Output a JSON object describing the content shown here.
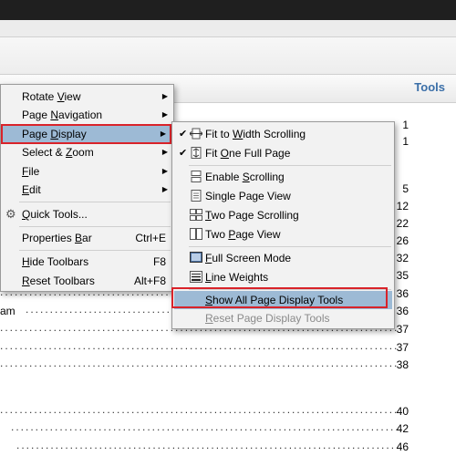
{
  "header": {
    "tools_label": "Tools"
  },
  "toc_numbers": [
    "1",
    "1",
    "5",
    "12",
    "22",
    "26",
    "32",
    "35",
    "36",
    "36",
    "37",
    "37",
    "38",
    "40",
    "42",
    "46"
  ],
  "toc_fragment": "am",
  "context_menu": {
    "items": [
      {
        "label_pre": "Rotate ",
        "label_u": "V",
        "label_post": "iew"
      },
      {
        "label_pre": "Page ",
        "label_u": "N",
        "label_post": "avigation"
      },
      {
        "label_pre": "Page ",
        "label_u": "D",
        "label_post": "isplay"
      },
      {
        "label_pre": "Select & ",
        "label_u": "Z",
        "label_post": "oom"
      },
      {
        "label_pre": "",
        "label_u": "F",
        "label_post": "ile"
      },
      {
        "label_pre": "",
        "label_u": "E",
        "label_post": "dit"
      },
      {
        "label_pre": "",
        "label_u": "Q",
        "label_post": "uick Tools..."
      },
      {
        "label_pre": "Properties ",
        "label_u": "B",
        "label_post": "ar",
        "shortcut": "Ctrl+E"
      },
      {
        "label_pre": "",
        "label_u": "H",
        "label_post": "ide Toolbars",
        "shortcut": "F8"
      },
      {
        "label_pre": "",
        "label_u": "R",
        "label_post": "eset Toolbars",
        "shortcut": "Alt+F8"
      }
    ]
  },
  "submenu": {
    "items": [
      {
        "label_pre": "Fit to ",
        "label_u": "W",
        "label_post": "idth Scrolling"
      },
      {
        "label_pre": "Fit ",
        "label_u": "O",
        "label_post": "ne Full Page"
      },
      {
        "label_pre": "Enable ",
        "label_u": "S",
        "label_post": "crolling"
      },
      {
        "label_pre": "Single Page View"
      },
      {
        "label_pre": "",
        "label_u": "T",
        "label_post": "wo Page Scrolling"
      },
      {
        "label_pre": "Two ",
        "label_u": "P",
        "label_post": "age View"
      },
      {
        "label_pre": "",
        "label_u": "F",
        "label_post": "ull Screen Mode"
      },
      {
        "label_pre": "",
        "label_u": "L",
        "label_post": "ine Weights"
      },
      {
        "label_pre": "",
        "label_u": "S",
        "label_post": "how All Page Display Tools"
      },
      {
        "label_pre": "",
        "label_u": "R",
        "label_post": "eset Page Display Tools"
      }
    ]
  }
}
